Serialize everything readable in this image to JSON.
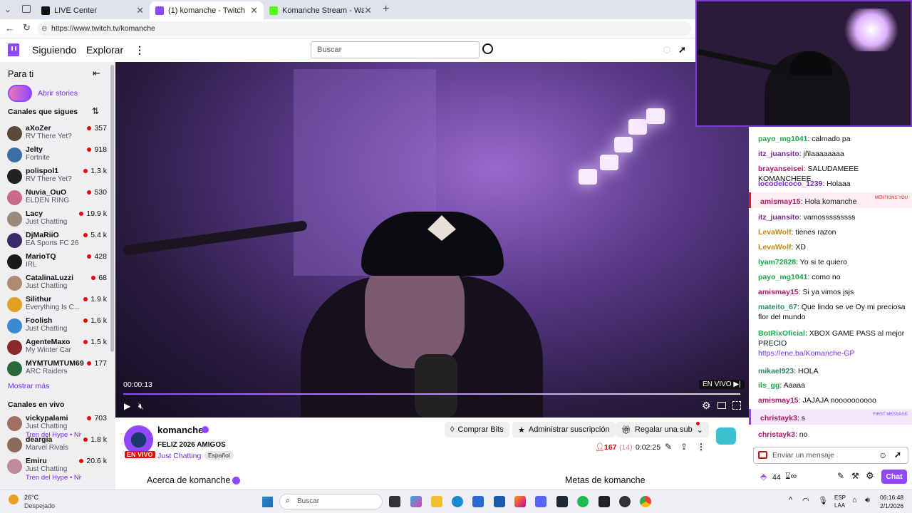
{
  "browser": {
    "tabs": [
      {
        "title": "LIVE Center"
      },
      {
        "title": "(1) komanche - Twitch"
      },
      {
        "title": "Komanche Stream - Watch Live on"
      }
    ],
    "url": "https://www.twitch.tv/komanche"
  },
  "nav": {
    "following": "Siguiendo",
    "browse": "Explorar",
    "search_placeholder": "Buscar"
  },
  "sidebar": {
    "for_you": "Para ti",
    "open_stories": "Abrir stories",
    "followed_header": "Canales que sigues",
    "followed": [
      {
        "name": "aXoZer",
        "game": "RV There Yet?",
        "viewers": "357",
        "color": "#5a4a3a"
      },
      {
        "name": "Jelty",
        "game": "Fortnite",
        "viewers": "918",
        "color": "#3a6ea5"
      },
      {
        "name": "polispol1",
        "game": "RV There Yet?",
        "viewers": "1.3 k",
        "color": "#222222"
      },
      {
        "name": "Nuvia_OuO",
        "game": "ELDEN RING",
        "viewers": "530",
        "color": "#c96a8a"
      },
      {
        "name": "Lacy",
        "game": "Just Chatting",
        "viewers": "19.9 k",
        "color": "#9a8a7a"
      },
      {
        "name": "DjMaRiiO",
        "game": "EA Sports FC 26",
        "viewers": "5.4 k",
        "color": "#3a2a6a"
      },
      {
        "name": "MarioTQ",
        "game": "IRL",
        "viewers": "428",
        "color": "#1a1a1a"
      },
      {
        "name": "CatalinaLuzzi",
        "game": "Just Chatting",
        "viewers": "68",
        "color": "#b08a70"
      },
      {
        "name": "Silithur",
        "game": "Everything Is C...",
        "viewers": "1.9 k",
        "color": "#e0a020"
      },
      {
        "name": "Foolish",
        "game": "Just Chatting",
        "viewers": "1.6 k",
        "color": "#3a8ad0"
      },
      {
        "name": "AgenteMaxo",
        "game": "My Winter Car",
        "viewers": "1.5 k",
        "color": "#8a2a2a"
      },
      {
        "name": "MYMTUMTUM69",
        "game": "ARC Raiders",
        "viewers": "177",
        "color": "#2a6a3a"
      }
    ],
    "show_more": "Mostrar más",
    "live_header": "Canales en vivo",
    "live": [
      {
        "name": "vickypalami",
        "game": "Just Chatting",
        "extra": "Tren del Hype • Niv...",
        "viewers": "703",
        "color": "#a07060"
      },
      {
        "name": "deargia",
        "game": "Marvel Rivals",
        "extra": "",
        "viewers": "1.8 k",
        "color": "#8a6a5a"
      },
      {
        "name": "Emiru",
        "game": "Just Chatting",
        "extra": "Tren del Hype • Niv...",
        "viewers": "20.6 k",
        "color": "#c08a9a"
      }
    ]
  },
  "video": {
    "time": "00:00:13",
    "live_badge": "EN VIVO"
  },
  "channel": {
    "name": "komanche",
    "title": "FELIZ 2026 AMIGOS",
    "category": "Just Chatting",
    "tag": "Español",
    "live_label": "EN VIVO",
    "viewers": "167",
    "viewers_extra": "(14)",
    "uptime": "0:02:25",
    "bits_btn": "Comprar Bits",
    "manage_sub_btn": "Administrar suscripción",
    "gift_sub_btn": "Regalar una sub",
    "about": "Acerca de komanche",
    "goals": "Metas de komanche"
  },
  "chat": {
    "messages": [
      {
        "user": "payo_mg1041",
        "text": ": calmado pa",
        "color": "#1ea84a",
        "type": ""
      },
      {
        "user": "itz_juansito",
        "text": ": jñlaaaaaaaa",
        "color": "#7a2a9a",
        "type": ""
      },
      {
        "user": "brayanseisei",
        "text": ": SALUDAMEEE KOMANCHEEE",
        "color": "#b0186a",
        "type": ""
      },
      {
        "user": "locodelcoco_1239",
        "text": ": Holaaa",
        "color": "#7a2ad0",
        "type": ""
      },
      {
        "user": "amismay15",
        "text": ": Hola komanche",
        "color": "#b0186a",
        "type": "mention",
        "tag": "MENTIONS YOU"
      },
      {
        "user": "itz_juansito",
        "text": ": vamosssssssss",
        "color": "#7a2a9a",
        "type": ""
      },
      {
        "user": "LevaWolf",
        "text": ": tienes razon",
        "color": "#c08a1a",
        "type": ""
      },
      {
        "user": "LevaWolf",
        "text": ": XD",
        "color": "#c08a1a",
        "type": ""
      },
      {
        "user": "lyam72828",
        "text": ": Yo si te quiero",
        "color": "#1ea84a",
        "type": ""
      },
      {
        "user": "payo_mg1041",
        "text": ": como no",
        "color": "#1ea84a",
        "type": ""
      },
      {
        "user": "amismay15",
        "text": ": Si ya vimos jsjs",
        "color": "#b0186a",
        "type": ""
      },
      {
        "user": "mateito_67",
        "text": ": Que lindo se ve Oy mi preciosa flor del mundo",
        "color": "#2a8a6a",
        "type": ""
      },
      {
        "user": "BotRixOficial",
        "text": ": XBOX GAME PASS al mejor PRECIO",
        "link": "https://ene.ba/Komanche-GP",
        "color": "#1ea84a",
        "type": "bot"
      },
      {
        "user": "mikael923",
        "text": ": HOLA",
        "color": "#2a8a6a",
        "type": ""
      },
      {
        "user": "ils_gg",
        "text": ": Aaaaa",
        "color": "#1ea84a",
        "type": ""
      },
      {
        "user": "amismay15",
        "text": ": JAJAJA noooooooooo",
        "color": "#b0186a",
        "type": ""
      },
      {
        "user": "christayk3",
        "text": ": s",
        "color": "#b0186a",
        "type": "first",
        "tag": "FIRST MESSAGE"
      },
      {
        "user": "christayk3",
        "text": ": no",
        "color": "#b0186a",
        "type": ""
      }
    ],
    "input_placeholder": "Enviar un mensaje",
    "points": "44",
    "chat_btn": "Chat"
  },
  "taskbar": {
    "temp": "26°C",
    "weather": "Despejado",
    "search": "Buscar",
    "lang1": "ESP",
    "lang2": "LAA",
    "time": "06:16:48",
    "date": "2/1/2026"
  }
}
